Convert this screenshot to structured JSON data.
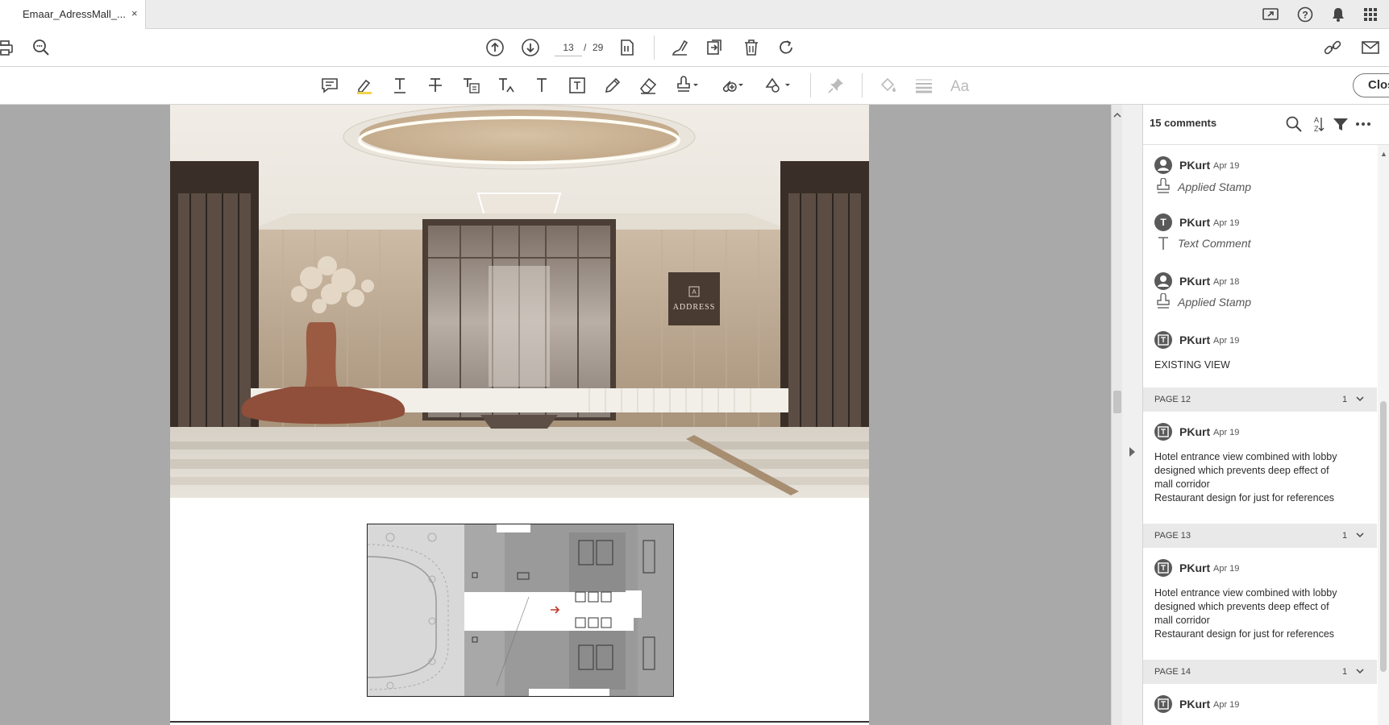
{
  "tab": {
    "title": "Emaar_AdressMall_...",
    "close": "×"
  },
  "toolbar": {
    "current_page": "13",
    "separator": "/",
    "total_pages": "29"
  },
  "comment_toolbar": {
    "close_label": "Close"
  },
  "document": {
    "sign_text": "ADDRESS",
    "sign_mark": "A"
  },
  "panel": {
    "count_label": "15 comments",
    "comments": [
      {
        "author": "PKurt",
        "date": "Apr 19",
        "type": "Applied Stamp",
        "avatar": "person"
      },
      {
        "author": "PKurt",
        "date": "Apr 19",
        "type": "Text Comment",
        "avatar": "T"
      },
      {
        "author": "PKurt",
        "date": "Apr 18",
        "type": "Applied Stamp",
        "avatar": "person"
      },
      {
        "author": "PKurt",
        "date": "Apr 19",
        "body": [
          "EXISTING VIEW"
        ],
        "avatar": "box"
      }
    ],
    "pages": [
      {
        "label": "PAGE 12",
        "count": "1",
        "comment": {
          "author": "PKurt",
          "date": "Apr 19",
          "body": [
            "Hotel entrance view combined with lobby",
            "designed which prevents deep effect of",
            "mall corridor",
            "Restaurant design for just for references"
          ]
        }
      },
      {
        "label": "PAGE 13",
        "count": "1",
        "comment": {
          "author": "PKurt",
          "date": "Apr 19",
          "body": [
            "Hotel entrance view combined with lobby",
            "designed which prevents deep effect of",
            "mall corridor",
            "Restaurant design for just for references"
          ]
        }
      },
      {
        "label": "PAGE 14",
        "count": "1",
        "comment": {
          "author": "PKurt",
          "date": "Apr 19"
        }
      }
    ]
  }
}
